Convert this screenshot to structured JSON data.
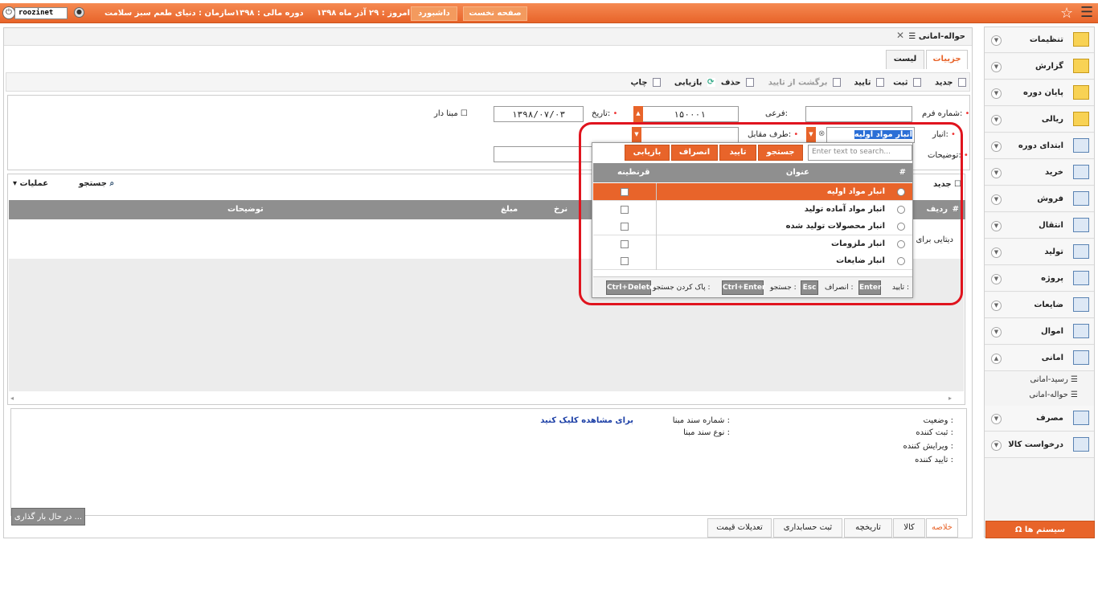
{
  "colors": {
    "accent": "#e8642a",
    "highlight": "#e0141e"
  },
  "topbar": {
    "user": "roozinet",
    "home": "صفحه نخست",
    "dashboard": "داشبورد",
    "today": "امروز : ۲۹ آذر ماه ۱۳۹۸",
    "fiscal": "دوره مالی : ۱۳۹۸",
    "org": "سازمان : دنیای طعم سبز سلامت"
  },
  "sidebar": {
    "items": [
      {
        "label": "تنظیمات",
        "icon": "settings-folder-icon"
      },
      {
        "label": "گزارش",
        "icon": "report-icon"
      },
      {
        "label": "پایان دوره",
        "icon": "period-end-icon"
      },
      {
        "label": "ریالی",
        "icon": "money-icon"
      },
      {
        "label": "ابتدای دوره",
        "icon": "grid-icon"
      },
      {
        "label": "خرید",
        "icon": "grid-icon"
      },
      {
        "label": "فروش",
        "icon": "grid-icon"
      },
      {
        "label": "انتقال",
        "icon": "grid-icon"
      },
      {
        "label": "تولید",
        "icon": "grid-icon"
      },
      {
        "label": "پروژه",
        "icon": "grid-icon"
      },
      {
        "label": "ضایعات",
        "icon": "grid-icon"
      },
      {
        "label": "اموال",
        "icon": "grid-icon"
      },
      {
        "label": "امانی",
        "icon": "grid-icon"
      }
    ],
    "sub": [
      "رسید-امانی",
      "حواله-امانی"
    ],
    "items2": [
      {
        "label": "مصرف",
        "icon": "grid-icon"
      },
      {
        "label": "درخواست کالا",
        "icon": "plus-icon"
      }
    ],
    "system": "سیستم ها"
  },
  "window": {
    "title": "حواله-امانی",
    "tabs": [
      "جزییات",
      "لیست"
    ]
  },
  "toolbar": {
    "new": "جدید",
    "save": "ثبت",
    "confirm": "تایید",
    "back": "برگشت از تایید",
    "delete": "حذف",
    "reload": "بازیابی",
    "print": "چاپ"
  },
  "form": {
    "form_no_label": "شماره فرم:",
    "form_no": "",
    "sub_label": "فرعی:",
    "sub": "۱۵۰۰۰۱",
    "date_label": "تاریخ:",
    "date": "۱۳۹۸/۰۷/۰۳",
    "based_label": "مبنا دار",
    "store_label": "انبار:",
    "store_value": "انبار مواد اولیه",
    "party_label": "طرف مقابل:",
    "desc_label": "توضیحات:"
  },
  "grid": {
    "new": "جدید",
    "search": "جستجو",
    "ops": "عملیات",
    "cols": [
      "#",
      "ردیف",
      "نرخ",
      "مبلغ",
      "توضیحات"
    ],
    "empty": "دیتایی برای"
  },
  "popup": {
    "search_placeholder": "Enter text to search...",
    "btn_search": "جستجو",
    "btn_ok": "تایید",
    "btn_cancel": "انصراف",
    "btn_reload": "بازیابی",
    "col_hash": "#",
    "col_title": "عنوان",
    "col_agent": "قرنطینه",
    "rows": [
      "انبار مواد اولیه",
      "انبار مواد آماده تولید",
      "انبار محصولات تولید شده",
      "انبار ملزومات",
      "انبار ضایعات"
    ],
    "footer": {
      "ok": "تایید :",
      "k_enter": "Enter",
      "cancel": "انصراف :",
      "k_esc": "Esc",
      "search": "جستجو :",
      "k_ce": "Ctrl+Enter",
      "clear": "پاک کردن جستجو :",
      "k_cd": "Ctrl+Delete"
    }
  },
  "lower": {
    "status": "وضعیت :",
    "creator": "ثبت کننده :",
    "editor": "ویرایش کننده :",
    "approver": "تایید کننده :",
    "src_no": "شماره سند مبنا :",
    "src_type": "نوع سند مبنا :",
    "view_link": "برای مشاهده کلیک کنید"
  },
  "bottom_tabs": [
    "خلاصه",
    "کالا",
    "تاریخچه",
    "ثبت حسابداری",
    "تعدیلات قیمت"
  ],
  "loading": "در حال بار گذاری ..."
}
